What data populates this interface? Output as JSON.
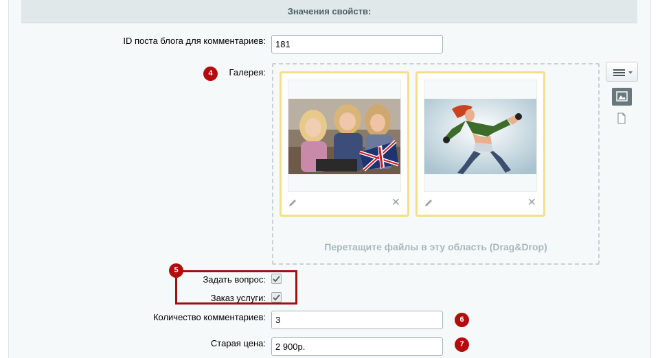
{
  "section": {
    "title": "Значения свойств:"
  },
  "fields": {
    "blog_post_id": {
      "label": "ID поста блога для комментариев:",
      "value": "181"
    },
    "gallery": {
      "label": "Галерея:",
      "drop_hint": "Перетащите файлы в эту область (Drag&Drop)"
    },
    "ask_question": {
      "label": "Задать вопрос:",
      "checked": true
    },
    "service_order": {
      "label": "Заказ услуги:",
      "checked": true
    },
    "comments_count": {
      "label": "Количество комментариев:",
      "value": "3"
    },
    "old_price": {
      "label": "Старая цена:",
      "value": "2 900р."
    }
  },
  "badges": {
    "gallery": "4",
    "checkboxes": "5",
    "comments": "6",
    "price": "7"
  },
  "colors": {
    "badge": "#b30c0c",
    "thumb_border": "#f3df87",
    "header_bg": "#e0e8ea",
    "highlight_box": "#a30f0f"
  },
  "icons": [
    "pencil-icon",
    "close-icon",
    "menu-icon",
    "chevron-down-icon",
    "image-view-icon",
    "file-icon",
    "checkmark-icon"
  ]
}
